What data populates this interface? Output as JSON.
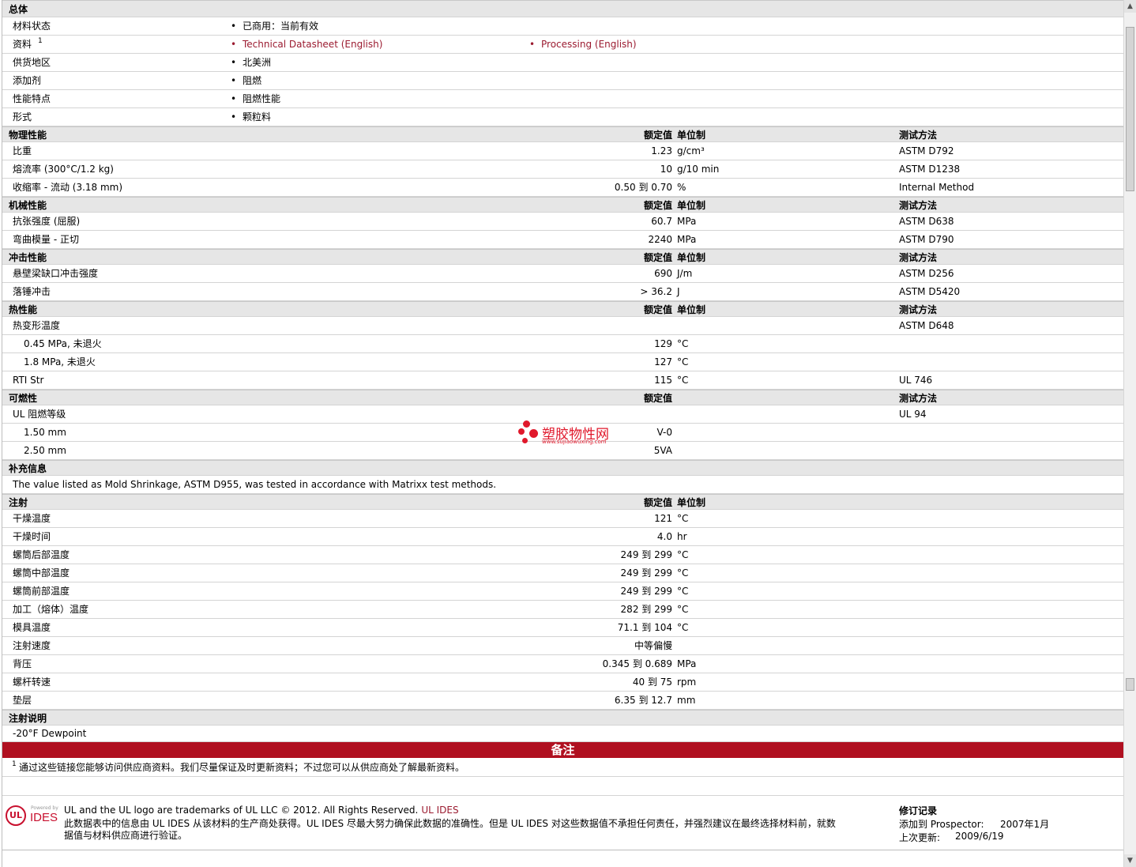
{
  "general": {
    "title": "总体",
    "rows": [
      {
        "label": "材料状态",
        "value": "已商用：当前有效"
      },
      {
        "label": "资料",
        "sup": "1",
        "links": [
          "Technical Datasheet (English)",
          "Processing (English)"
        ]
      },
      {
        "label": "供货地区",
        "value": "北美洲"
      },
      {
        "label": "添加剂",
        "value": "阻燃"
      },
      {
        "label": "性能特点",
        "value": "阻燃性能"
      },
      {
        "label": "形式",
        "value": "颗粒料"
      }
    ]
  },
  "column_headers": {
    "nominal": "额定值",
    "unit": "单位制",
    "method": "测试方法"
  },
  "sections": [
    {
      "title": "物理性能",
      "show_unit_header": true,
      "show_method_header": true,
      "rows": [
        {
          "label": "比重",
          "value": "1.23",
          "unit": "g/cm³",
          "method": "ASTM D792"
        },
        {
          "label": "熔流率  (300°C/1.2 kg)",
          "value": "10",
          "unit": "g/10 min",
          "method": "ASTM D1238"
        },
        {
          "label": "收缩率  - 流动  (3.18 mm)",
          "value": "0.50 到  0.70",
          "unit": "%",
          "method": "Internal Method"
        }
      ]
    },
    {
      "title": "机械性能",
      "show_unit_header": true,
      "show_method_header": true,
      "rows": [
        {
          "label": "抗张强度  (屈服)",
          "value": "60.7",
          "unit": "MPa",
          "method": "ASTM D638"
        },
        {
          "label": "弯曲模量  - 正切",
          "value": "2240",
          "unit": "MPa",
          "method": "ASTM D790"
        }
      ]
    },
    {
      "title": "冲击性能",
      "show_unit_header": true,
      "show_method_header": true,
      "rows": [
        {
          "label": "悬壁梁缺口冲击强度",
          "value": "690",
          "unit": "J/m",
          "method": "ASTM D256"
        },
        {
          "label": "落锤冲击",
          "value": "> 36.2",
          "unit": "J",
          "method": "ASTM D5420"
        }
      ]
    },
    {
      "title": "热性能",
      "show_unit_header": true,
      "show_method_header": true,
      "rows": [
        {
          "label": "热变形温度",
          "value": "",
          "unit": "",
          "method": "ASTM D648"
        },
        {
          "label": "0.45 MPa, 未退火",
          "indent": true,
          "value": "129",
          "unit": "°C",
          "method": ""
        },
        {
          "label": "1.8 MPa, 未退火",
          "indent": true,
          "value": "127",
          "unit": "°C",
          "method": ""
        },
        {
          "label": "RTI Str",
          "value": "115",
          "unit": "°C",
          "method": "UL 746"
        }
      ]
    },
    {
      "title": "可燃性",
      "show_unit_header": false,
      "show_method_header": true,
      "rows": [
        {
          "label": "UL 阻燃等级",
          "value": "",
          "unit": "",
          "method": "UL 94"
        },
        {
          "label": "1.50 mm",
          "indent": true,
          "value": "V-0",
          "unit": "",
          "method": ""
        },
        {
          "label": "2.50 mm",
          "indent": true,
          "value": "5VA",
          "unit": "",
          "method": ""
        }
      ]
    }
  ],
  "supplemental": {
    "title": "补充信息",
    "text": "The value listed as Mold Shrinkage, ASTM D955, was tested in accordance with Matrixx test methods."
  },
  "injection": {
    "title": "注射",
    "rows": [
      {
        "label": "干燥温度",
        "value": "121",
        "unit": "°C"
      },
      {
        "label": "干燥时间",
        "value": "4.0",
        "unit": "hr"
      },
      {
        "label": "螺筒后部温度",
        "value": "249 到  299",
        "unit": "°C"
      },
      {
        "label": "螺筒中部温度",
        "value": "249 到  299",
        "unit": "°C"
      },
      {
        "label": "螺筒前部温度",
        "value": "249 到  299",
        "unit": "°C"
      },
      {
        "label": "加工（熔体）温度",
        "value": "282 到  299",
        "unit": "°C"
      },
      {
        "label": "模具温度",
        "value": "71.1 到  104",
        "unit": "°C"
      },
      {
        "label": "注射速度",
        "value": "中等偏慢",
        "unit": ""
      },
      {
        "label": "背压",
        "value": "0.345 到  0.689",
        "unit": "MPa"
      },
      {
        "label": "螺杆转速",
        "value": "40 到  75",
        "unit": "rpm"
      },
      {
        "label": "垫层",
        "value": "6.35 到  12.7",
        "unit": "mm"
      }
    ]
  },
  "injection_notes": {
    "title": "注射说明",
    "text": "-20°F Dewpoint"
  },
  "notes": {
    "title": "备注",
    "sup": "1",
    "text": "通过这些链接您能够访问供应商资料。我们尽量保证及时更新资料；不过您可以从供应商处了解最新资料。"
  },
  "footer": {
    "logo_ul": "UL",
    "logo_powered": "Powered by",
    "logo_ides": "IDES",
    "trademark": "UL and the UL logo are trademarks of UL LLC © 2012. All Rights Reserved.",
    "trademark_link": "UL IDES",
    "disclaimer_line1": "此数据表中的信息由  UL IDES 从该材料的生产商处获得。UL IDES 尽最大努力确保此数据的准确性。但是  UL IDES 对这些数据值不承担任何责任，并强烈建议在最终选择材料前，就数",
    "disclaimer_line2": "据值与材料供应商进行验证。",
    "revision_title": "修订记录",
    "added_label": "添加到  Prospector:",
    "added_value": "2007年1月",
    "updated_label": "上次更新:",
    "updated_value": "2009/6/19"
  },
  "watermark": {
    "text": "塑胶物性网",
    "url": "www.sujiaowuxing.com"
  }
}
